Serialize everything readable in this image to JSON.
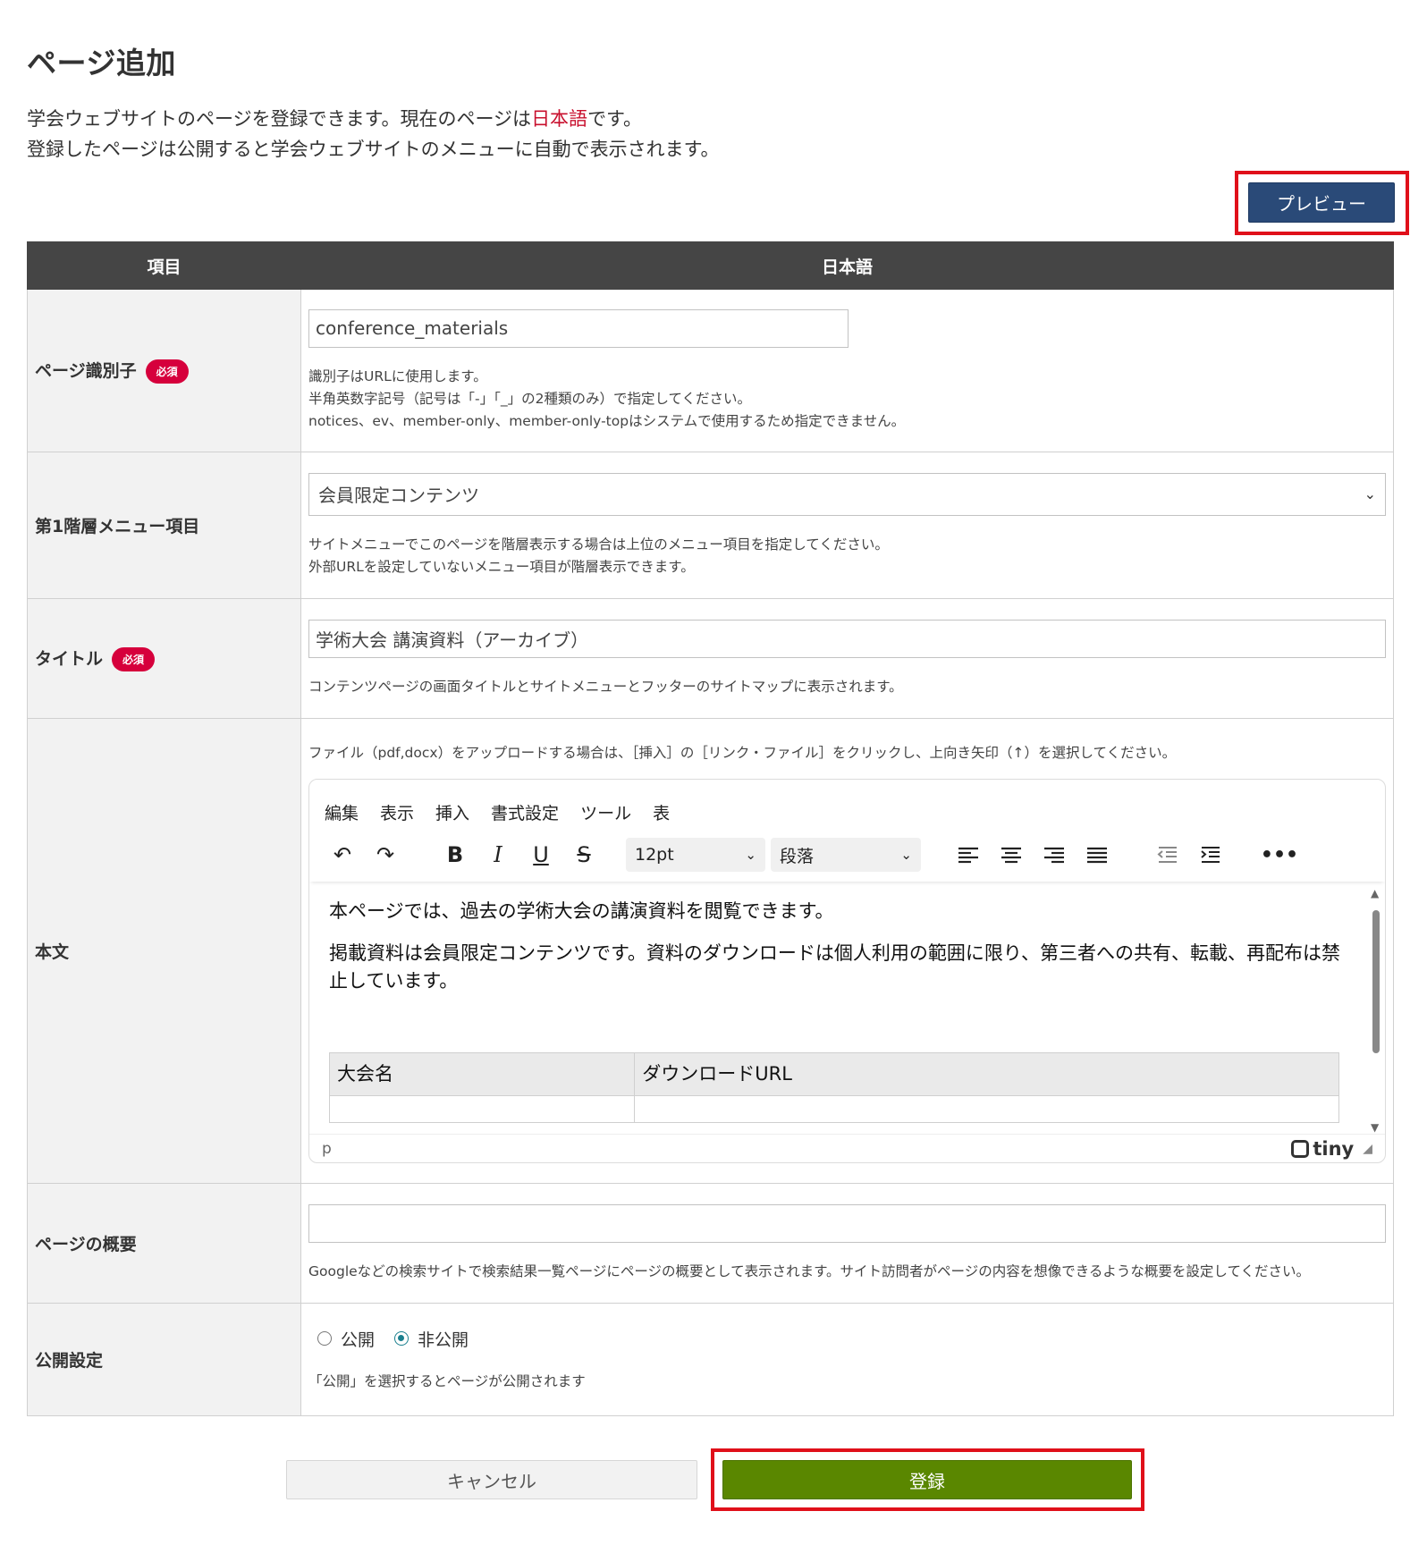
{
  "page": {
    "title": "ページ追加",
    "intro_line1_prefix": "学会ウェブサイトのページを登録できます。現在のページは",
    "intro_lang": "日本語",
    "intro_line1_suffix": "です。",
    "intro_line2": "登録したページは公開すると学会ウェブサイトのメニューに自動で表示されます。",
    "preview_label": "プレビュー"
  },
  "table": {
    "header_item": "項目",
    "header_lang": "日本語",
    "required_badge": "必須"
  },
  "identifier": {
    "label": "ページ識別子",
    "value": "conference_materials",
    "help1": "識別子はURLに使用します。",
    "help2": "半角英数字記号（記号は「-」「_」の2種類のみ）で指定してください。",
    "help3": "notices、ev、member-only、member-only-topはシステムで使用するため指定できません。"
  },
  "menu": {
    "label": "第1階層メニュー項目",
    "selected": "会員限定コンテンツ",
    "help1": "サイトメニューでこのページを階層表示する場合は上位のメニュー項目を指定してください。",
    "help2": "外部URLを設定していないメニュー項目が階層表示できます。"
  },
  "title_field": {
    "label": "タイトル",
    "value": "学術大会 講演資料（アーカイブ）",
    "help": "コンテンツページの画面タイトルとサイトメニューとフッターのサイトマップに表示されます。"
  },
  "body": {
    "label": "本文",
    "help": "ファイル（pdf,docx）をアップロードする場合は、［挿入］の［リンク・ファイル］をクリックし、上向き矢印（↑）を選択してください。",
    "menubar": [
      "編集",
      "表示",
      "挿入",
      "書式設定",
      "ツール",
      "表"
    ],
    "font_size": "12pt",
    "block_format": "段落",
    "paragraph1": "本ページでは、過去の学術大会の講演資料を閲覧できます。",
    "paragraph2": "掲載資料は会員限定コンテンツです。資料のダウンロードは個人利用の範囲に限り、第三者への共有、転載、再配布は禁止しています。",
    "table_col1": "大会名",
    "table_col2": "ダウンロードURL",
    "status_path": "p",
    "brand": "tiny"
  },
  "summary": {
    "label": "ページの概要",
    "value": "",
    "help": "Googleなどの検索サイトで検索結果一覧ページにページの概要として表示されます。サイト訪問者がページの内容を想像できるような概要を設定してください。"
  },
  "publish": {
    "label": "公開設定",
    "option_public": "公開",
    "option_private": "非公開",
    "selected": "非公開",
    "help": "「公開」を選択するとページが公開されます"
  },
  "actions": {
    "cancel_label": "キャンセル",
    "submit_label": "登録"
  },
  "colors": {
    "preview_button": "#2a4a78",
    "submit_button": "#5a8700",
    "highlight_outline": "#e0101a",
    "required_badge": "#d6003c",
    "language_text": "#c8102e"
  }
}
